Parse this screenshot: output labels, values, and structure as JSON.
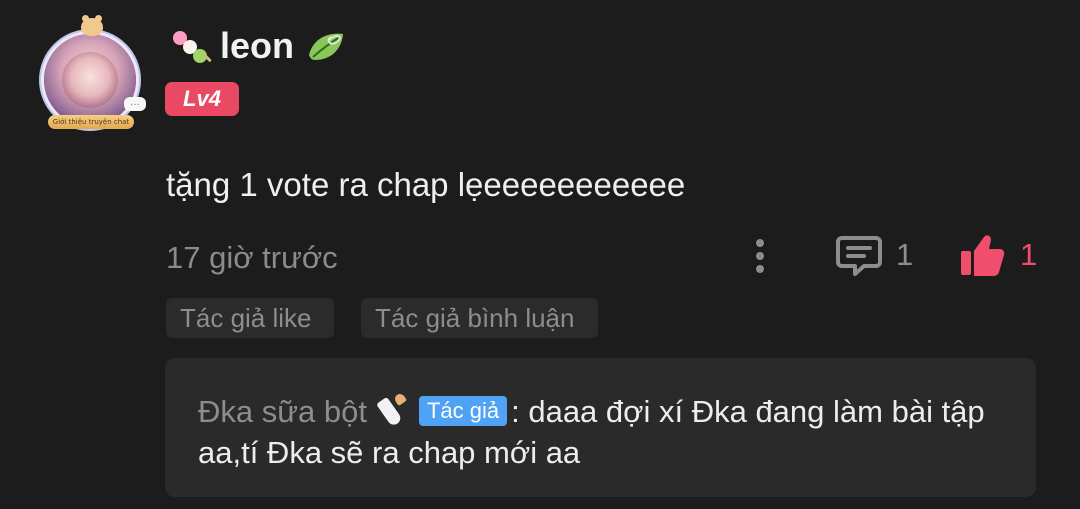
{
  "comment": {
    "username": "leon",
    "level": "Lv4",
    "avatar_ribbon": "Giới thiệu truyện chat",
    "text": "tặng 1 vote ra chap lẹeeeeeeeeeee",
    "time": "17 giờ trước",
    "comment_count": "1",
    "like_count": "1",
    "chips": [
      "Tác giả like",
      "Tác giả bình luận"
    ],
    "icons": {
      "avatar": "avatar-image",
      "name_badge": "dango-icon",
      "after_name": "leaf-icon",
      "more": "more-vertical-icon",
      "comment": "comment-icon",
      "like": "thumbs-up-icon",
      "reply_author": "baby-bottle-icon"
    }
  },
  "reply": {
    "author": "Đka sữa bột",
    "author_tag": "Tác giả",
    "text": ": daaa đợi xí Đka đang làm bài tập aa,tí Đka sẽ ra chap mới aa"
  },
  "colors": {
    "background": "#1c1c1d",
    "level_badge": "#ea4964",
    "like": "#ef4e6d",
    "author_tag": "#4fa2f4"
  }
}
